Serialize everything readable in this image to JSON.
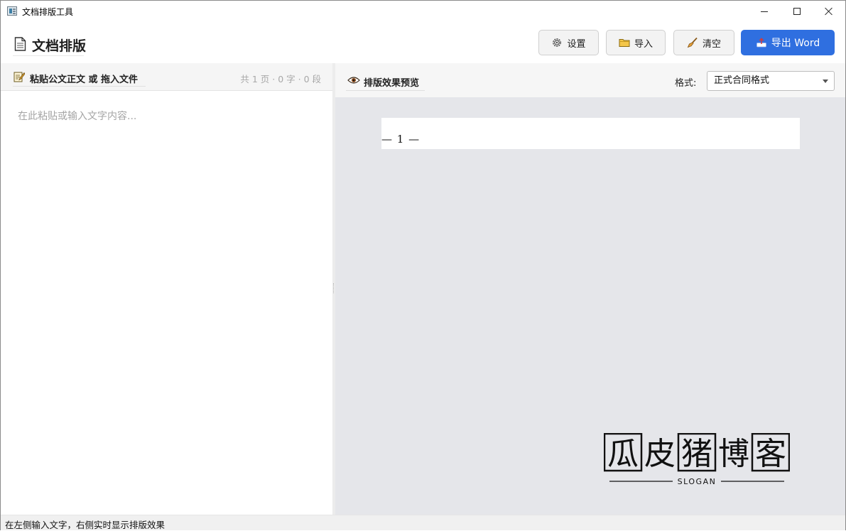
{
  "window": {
    "title": "文档排版工具"
  },
  "header": {
    "title": "文档排版",
    "buttons": {
      "settings": "设置",
      "import": "导入",
      "clear": "清空",
      "export": "导出 Word"
    }
  },
  "left_panel": {
    "title": "粘贴公文正文 或 拖入文件",
    "stats": "共 1 页 · 0 字 · 0 段",
    "editor_placeholder": "在此粘贴或输入文字内容...",
    "editor_value": ""
  },
  "right_panel": {
    "title": "排版效果预览",
    "format_label": "格式:",
    "format_selected": "正式合同格式",
    "page_number_text": "— 1 —"
  },
  "watermark": {
    "text": "瓜皮猪博客",
    "slogan": "SLOGAN"
  },
  "statusbar": {
    "text": "在左侧输入文字，右侧实时显示排版效果"
  },
  "colors": {
    "accent": "#2f6fe0",
    "preview_bg": "#e5e6ea",
    "panel_header_bg": "#f5f5f5"
  },
  "icons": {
    "settings": "gear-icon",
    "import": "folder-icon",
    "clear": "broom-icon",
    "export": "export-icon",
    "header": "document-icon",
    "left_title": "edit-note-icon",
    "right_title": "eye-icon"
  }
}
